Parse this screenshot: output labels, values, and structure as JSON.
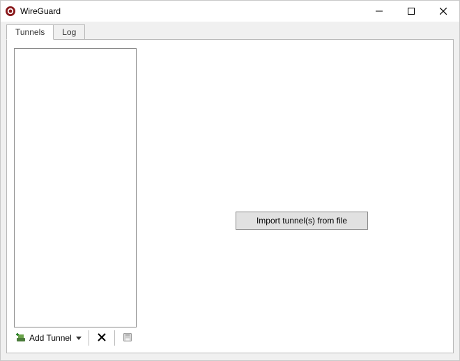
{
  "window": {
    "title": "WireGuard"
  },
  "tabs": [
    {
      "label": "Tunnels"
    },
    {
      "label": "Log"
    }
  ],
  "toolbar": {
    "add_tunnel_label": "Add Tunnel"
  },
  "main": {
    "import_button_label": "Import tunnel(s) from file"
  }
}
